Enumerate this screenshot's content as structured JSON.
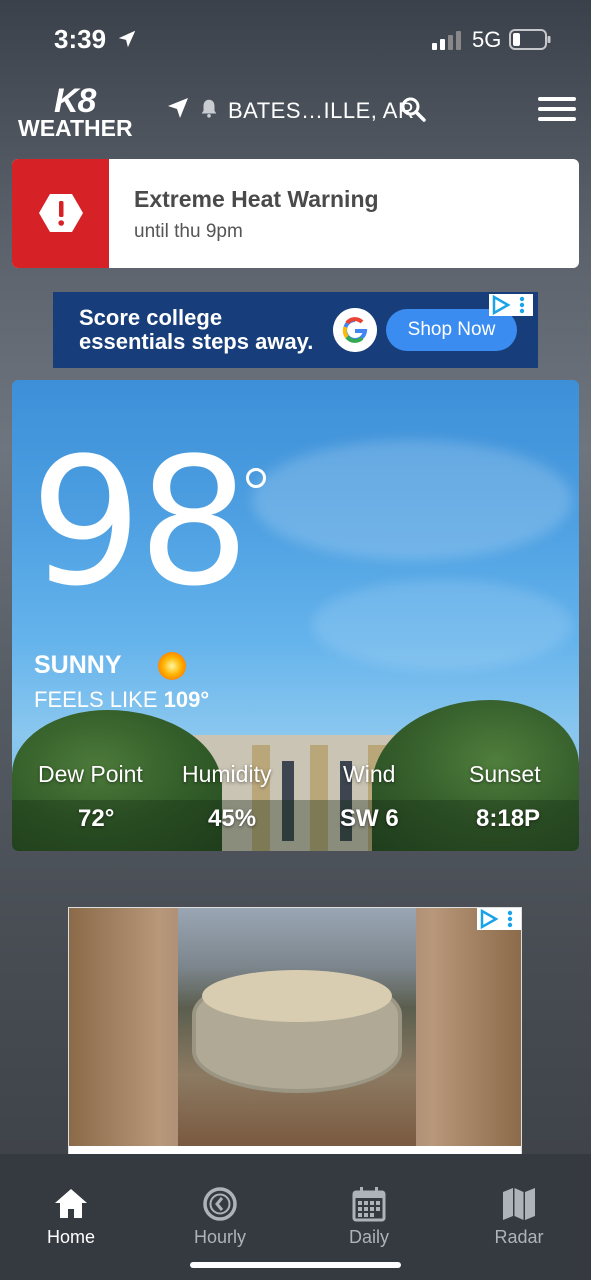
{
  "status_bar": {
    "time": "3:39",
    "network": "5G"
  },
  "header": {
    "logo_k8": "K8",
    "logo_weather": "WEATHER",
    "location": "BATES…ILLE, AR"
  },
  "alert": {
    "title": "Extreme Heat Warning",
    "subtitle": "until thu 9pm",
    "color": "#d62226"
  },
  "ad_top": {
    "text_line1": "Score college",
    "text_line2": "essentials steps away.",
    "button": "Shop Now"
  },
  "current": {
    "temperature": "98",
    "condition": "SUNNY",
    "feels_like_label": "FEELS LIKE",
    "feels_like_value": "109°",
    "stats": [
      {
        "label": "Dew Point",
        "value": "72°"
      },
      {
        "label": "Humidity",
        "value": "45%"
      },
      {
        "label": "Wind",
        "value": "SW 6"
      },
      {
        "label": "Sunset",
        "value": "8:18P"
      }
    ]
  },
  "tabs": [
    {
      "label": "Home",
      "icon": "home-icon",
      "active": true
    },
    {
      "label": "Hourly",
      "icon": "clock-icon",
      "active": false
    },
    {
      "label": "Daily",
      "icon": "calendar-icon",
      "active": false
    },
    {
      "label": "Radar",
      "icon": "map-icon",
      "active": false
    }
  ]
}
